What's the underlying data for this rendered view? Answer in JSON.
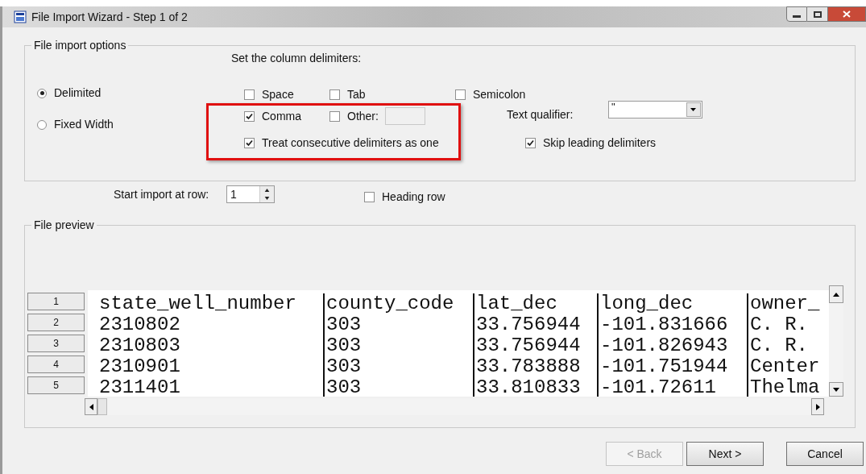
{
  "window": {
    "title": "File Import Wizard - Step 1 of 2"
  },
  "options": {
    "title": "File import options",
    "delimiters_label": "Set the column delimiters:",
    "modes": [
      {
        "label": "Delimited",
        "selected": true
      },
      {
        "label": "Fixed Width",
        "selected": false
      }
    ],
    "delimiters": [
      {
        "label": "Space",
        "checked": false
      },
      {
        "label": "Tab",
        "checked": false
      },
      {
        "label": "Semicolon",
        "checked": false
      },
      {
        "label": "Comma",
        "checked": true
      },
      {
        "label": "Other:",
        "checked": false
      }
    ],
    "treat_consecutive": {
      "label": "Treat consecutive delimiters as one",
      "checked": true
    },
    "text_qualifier": {
      "label": "Text qualifier:",
      "value": "\""
    },
    "skip_leading": {
      "label": "Skip leading delimiters",
      "checked": true
    },
    "highlighted": true
  },
  "start_row": {
    "label": "Start import at row:",
    "value": "1"
  },
  "heading_row": {
    "label": "Heading row",
    "checked": false
  },
  "preview": {
    "title": "File preview",
    "rows": [
      {
        "number": "1",
        "cells": [
          "state_well_number",
          "county_code",
          "lat_dec",
          "long_dec",
          "owner_"
        ]
      },
      {
        "number": "2",
        "cells": [
          "2310802",
          "303",
          "33.756944",
          "-101.831666",
          "C. R."
        ]
      },
      {
        "number": "3",
        "cells": [
          "2310803",
          "303",
          "33.756944",
          "-101.826943",
          "C. R."
        ]
      },
      {
        "number": "4",
        "cells": [
          "2310901",
          "303",
          "33.783888",
          "-101.751944",
          "Center"
        ]
      },
      {
        "number": "5",
        "cells": [
          "2311401",
          "303",
          "33.810833",
          "-101.72611",
          "Thelma"
        ]
      }
    ]
  },
  "buttons": [
    {
      "label": "< Back",
      "disabled": true
    },
    {
      "label": "Next >",
      "disabled": false
    },
    {
      "label": "Cancel",
      "disabled": false
    }
  ]
}
